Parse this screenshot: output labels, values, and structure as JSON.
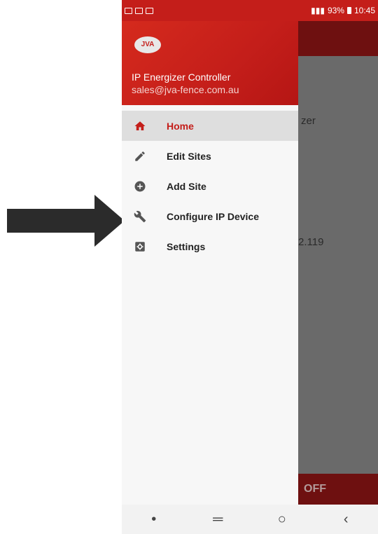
{
  "status": {
    "battery": "93%",
    "time": "10:45"
  },
  "background": {
    "partial_text_1": "zer",
    "partial_text_2": "2.119",
    "off_label": "OFF"
  },
  "drawer": {
    "logo_text": "JVA",
    "title": "IP Energizer Controller",
    "email": "sales@jva-fence.com.au",
    "items": [
      {
        "label": "Home",
        "icon": "home-icon"
      },
      {
        "label": "Edit Sites",
        "icon": "pencil-icon"
      },
      {
        "label": "Add Site",
        "icon": "add-circle-icon"
      },
      {
        "label": "Configure IP Device",
        "icon": "wrench-icon"
      },
      {
        "label": "Settings",
        "icon": "settings-icon"
      }
    ]
  },
  "colors": {
    "accent": "#c41e1a",
    "dark_toolbar": "#6e1010"
  }
}
